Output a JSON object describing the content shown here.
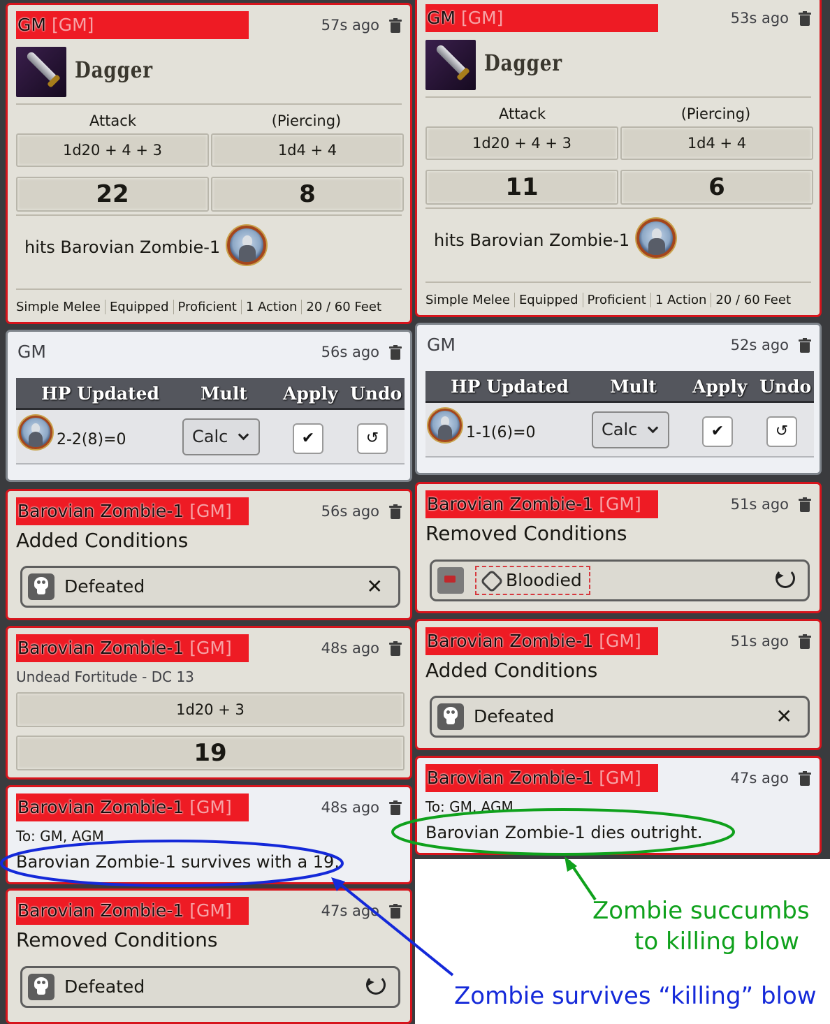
{
  "left": {
    "attack_card": {
      "sender": "GM",
      "sender_tag": "[GM]",
      "time": "57s ago",
      "item": "Dagger",
      "attack_label": "Attack",
      "damage_label": "(Piercing)",
      "attack_formula": "1d20 + 4 + 3",
      "damage_formula": "1d4 + 4",
      "attack_total": "22",
      "damage_total": "8",
      "hits_text": "hits Barovian Zombie-1",
      "props": [
        "Simple Melee",
        "Equipped",
        "Proficient",
        "1 Action",
        "20 / 60 Feet"
      ]
    },
    "hp_card": {
      "sender": "GM",
      "time": "56s ago",
      "headers": [
        "HP Updated",
        "Mult",
        "Apply",
        "Undo"
      ],
      "hp_value": "2-2(8)=0",
      "mult": "Calc"
    },
    "cond_added": {
      "sender": "Barovian Zombie-1",
      "sender_tag": "[GM]",
      "time": "56s ago",
      "title": "Added Conditions",
      "condition": "Defeated"
    },
    "save_card": {
      "sender": "Barovian Zombie-1",
      "sender_tag": "[GM]",
      "time": "48s ago",
      "subtitle": "Undead Fortitude - DC 13",
      "formula": "1d20 + 3",
      "total": "19"
    },
    "whisper": {
      "sender": "Barovian Zombie-1",
      "sender_tag": "[GM]",
      "time": "48s ago",
      "to": "To: GM, AGM",
      "message": "Barovian Zombie-1 survives with a 19."
    },
    "cond_removed": {
      "sender": "Barovian Zombie-1",
      "sender_tag": "[GM]",
      "time": "47s ago",
      "title": "Removed Conditions",
      "condition": "Defeated"
    }
  },
  "right": {
    "attack_card": {
      "sender": "GM",
      "sender_tag": "[GM]",
      "time": "53s ago",
      "item": "Dagger",
      "attack_label": "Attack",
      "damage_label": "(Piercing)",
      "attack_formula": "1d20 + 4 + 3",
      "damage_formula": "1d4 + 4",
      "attack_total": "11",
      "damage_total": "6",
      "hits_text": "hits Barovian Zombie-1",
      "props": [
        "Simple Melee",
        "Equipped",
        "Proficient",
        "1 Action",
        "20 / 60 Feet"
      ]
    },
    "hp_card": {
      "sender": "GM",
      "time": "52s ago",
      "headers": [
        "HP Updated",
        "Mult",
        "Apply",
        "Undo"
      ],
      "hp_value": "1-1(6)=0",
      "mult": "Calc"
    },
    "cond_removed": {
      "sender": "Barovian Zombie-1",
      "sender_tag": "[GM]",
      "time": "51s ago",
      "title": "Removed Conditions",
      "condition": "Bloodied"
    },
    "cond_added": {
      "sender": "Barovian Zombie-1",
      "sender_tag": "[GM]",
      "time": "51s ago",
      "title": "Added Conditions",
      "condition": "Defeated"
    },
    "whisper": {
      "sender": "Barovian Zombie-1",
      "sender_tag": "[GM]",
      "time": "47s ago",
      "to": "To: GM, AGM",
      "message": "Barovian Zombie-1 dies outright."
    }
  },
  "annotations": {
    "green_line1": "Zombie succumbs",
    "green_line2": "to killing blow",
    "blue": "Zombie survives “killing” blow",
    "colors": {
      "green": "#0fa11c",
      "blue": "#1429d9",
      "sender_bar": "#ee1b24"
    }
  },
  "icons": {
    "delete": "trash-icon",
    "item": "dagger-icon",
    "token": "zombie-token-icon",
    "condition_defeated": "skull-icon",
    "condition_bloodied": "blood-icon",
    "apply": "check-icon",
    "undo": "undo-icon",
    "remove": "close-icon"
  }
}
